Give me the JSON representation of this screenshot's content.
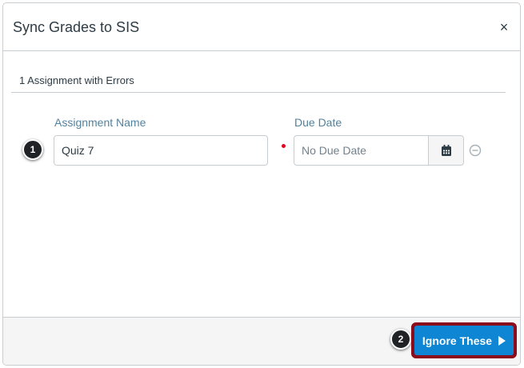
{
  "dialog": {
    "title": "Sync Grades to SIS",
    "close_glyph": "×"
  },
  "errors": {
    "heading": "1 Assignment with Errors"
  },
  "fields": {
    "assignment_name_label": "Assignment Name",
    "assignment_name_value": "Quiz 7",
    "due_date_label": "Due Date",
    "due_date_placeholder": "No Due Date"
  },
  "callouts": {
    "step_1": "1",
    "step_2": "2"
  },
  "footer": {
    "ignore_label": "Ignore These"
  },
  "colors": {
    "primary": "#0e86d4",
    "highlight_border": "#8b0d1c",
    "required": "#e0061f",
    "label": "#52829e"
  },
  "icons": {
    "close": "close-icon",
    "calendar": "calendar-icon",
    "remove": "minus-circle-icon",
    "play": "play-icon"
  }
}
